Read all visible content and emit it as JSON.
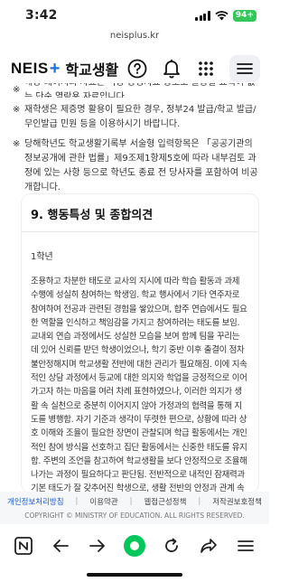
{
  "status_bar": {
    "time": "3:42",
    "battery": "94+"
  },
  "browser": {
    "url": "neisplus.kr"
  },
  "header": {
    "logo_text": "NEIS",
    "logo_plus": "+",
    "title": "학교생활"
  },
  "notes": [
    {
      "mark": "※",
      "text": "해당 페이지의 자료는 각종 증빙자료 용도로 활용될 효력이 없는 단순 열람용 자료입니다."
    },
    {
      "mark": "※",
      "text": "재학생은 제증명 활용이 필요한 경우, 정부24 발급/학교 발급/무인발급 민원 등을 이용하시기 바랍니다."
    },
    {
      "mark": "※",
      "text": "당해학년도 학교생활기록부 서술형 입력항목은 「공공기관의 정보공개에 관한 법률」제9조제1항제5호에 따라 내부검토 과정에 있는 사항 등으로 학년도 종료 전 당사자를 포함하여 비공개합니다."
    }
  ],
  "section": {
    "title": "9. 행동특성 및 종합의견",
    "grade_label": "1학년",
    "content": "조용하고 차분한 태도로 교사의 지시에 따라 학습 활동과 과제 수행에 성실히 참여하는 학생임. 학교 행사에서 기타 연주자로 참여하여 전공과 관련된 경험을 쌓았으며, 합주 연습에서도 필요한 역할을 인식하고 책임감을 가지고 참여하려는 태도를 보임. 교내외 연습 과정에서도 성실한 모습을 보여 함께 팀을 꾸리는 데 있어 신뢰를 받던 학생이었으나, 학기 중반 이후 출결이 점차 불안정해지며 학교생활 전반에 대한 관리가 필요해짐. 이에 지속적인 상담 과정에서 등교에 대한 의지와 학업을 긍정적으로 이어가고자 하는 마음을 여러 차례 표현하였으나, 이러한 의지가 생활 속 실천으로 충분히 이어지지 않아 가정과의 협력을 통해 지도를 병행함. 자기 기준과 생각이 뚜렷한 편으로, 상황에 따라 상호 이해와 조율이 필요한 장면이 관찰되며 학급 활동에서는 개인적인 참여 방식을 선호하고 집단 활동에서는 신중한 태도를 유지함. 주변의 조언을 참고하여 학교생활을 보다 안정적으로 조율해 나가는 과정이 필요하다고 판단됨. 전반적으로 내적인 잠재력과 기본 태도가 잘 갖추어진 학생으로, 생활 전반의 안정과 관계 속 조율 경험이 더해질 경우 학교생활과 진로 영역에서 의미 있는 성장을 이룰 수 있을 것으로 기대됨."
  },
  "footer": {
    "links": [
      "개인정보처리방침",
      "이용약관",
      "웹접근성정책",
      "저작권보호정책"
    ],
    "separator": "|",
    "copyright": "COPYRIGHT © MINISTRY OF EDUCATION. ALL RIGHTS RESERVED."
  },
  "icons": {
    "help": "help-circle-icon",
    "notifications": "bell-icon",
    "apps": "grid-icon",
    "menu": "hamburger-menu-icon"
  },
  "colors": {
    "brand_blue": "#1e6fe0",
    "battery_green": "#34c759",
    "link_blue": "#1a5fd0",
    "naver_green": "#03c75a"
  }
}
